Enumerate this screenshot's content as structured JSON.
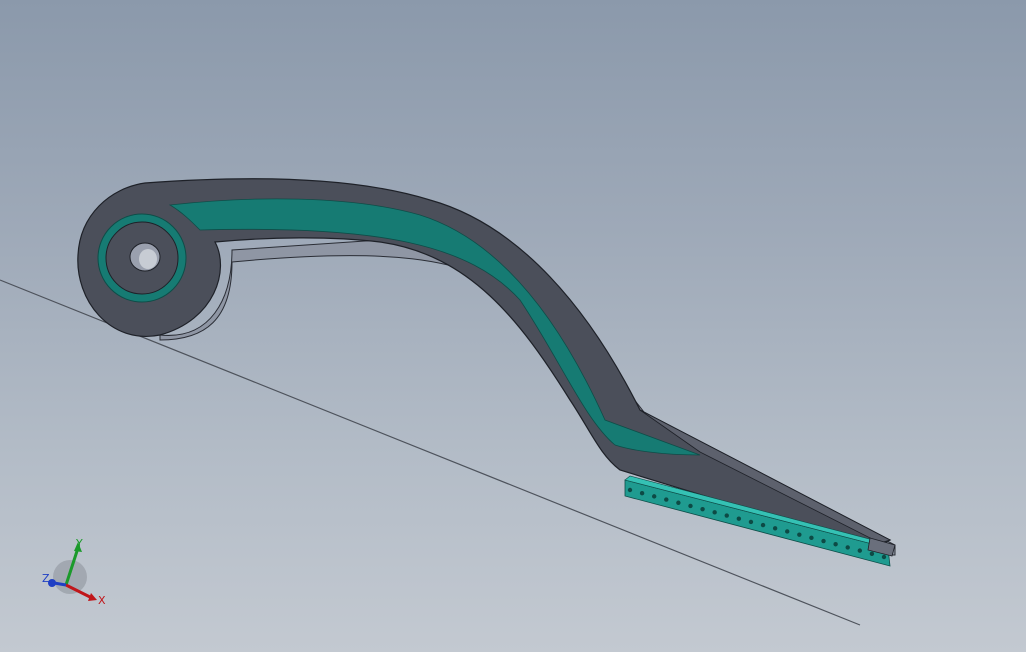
{
  "viewport": {
    "background_top": "#8b99ab",
    "background_bottom": "#c3c9d1"
  },
  "model": {
    "body_color": "#4a4e59",
    "body_top_color": "#6a6f7c",
    "body_light_color": "#9aa0ae",
    "insert_color": "#157a73",
    "insert_light_color": "#22a89d",
    "edge_color": "#1e2128"
  },
  "triad": {
    "x_label": "X",
    "y_label": "Y",
    "z_label": "Z",
    "x_color": "#c0161a",
    "y_color": "#1b9a2b",
    "z_color": "#1f3fc4"
  }
}
